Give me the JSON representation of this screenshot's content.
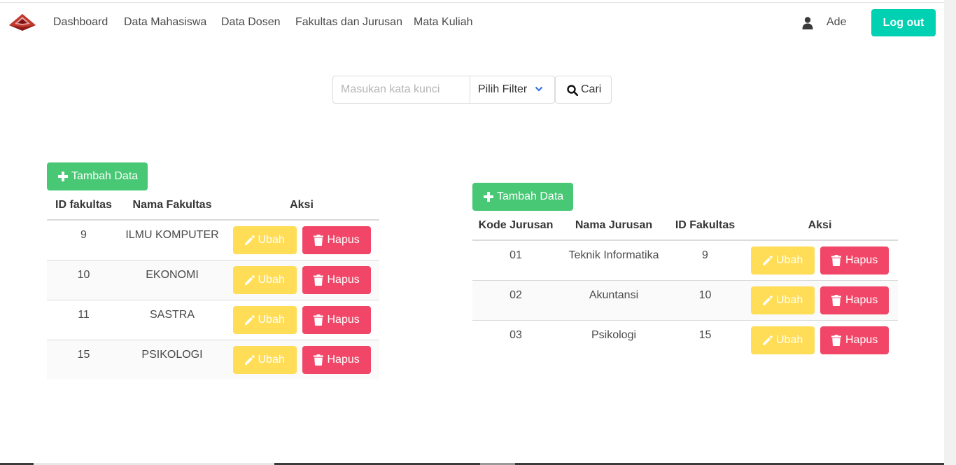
{
  "nav": {
    "items": [
      "Dashboard",
      "Data Mahasiswa",
      "Data Dosen",
      "Fakultas dan Jurusan",
      "Mata Kuliah"
    ],
    "user": "Ade",
    "logout": "Log out"
  },
  "search": {
    "placeholder": "Masukan kata kunci",
    "filter": "Pilih Filter",
    "button": "Cari"
  },
  "fakultas": {
    "add_label": "Tambah Data",
    "headers": [
      "ID fakultas",
      "Nama Fakultas",
      "Aksi"
    ],
    "rows": [
      {
        "id": "9",
        "nama": "ILMU KOMPUTER"
      },
      {
        "id": "10",
        "nama": "EKONOMI"
      },
      {
        "id": "11",
        "nama": "SASTRA"
      },
      {
        "id": "15",
        "nama": "PSIKOLOGI"
      }
    ]
  },
  "jurusan": {
    "add_label": "Tambah Data",
    "headers": [
      "Kode Jurusan",
      "Nama Jurusan",
      "ID Fakultas",
      "Aksi"
    ],
    "rows": [
      {
        "kode": "01",
        "nama": "Teknik Informatika",
        "id_fakultas": "9"
      },
      {
        "kode": "02",
        "nama": "Akuntansi",
        "id_fakultas": "10"
      },
      {
        "kode": "03",
        "nama": "Psikologi",
        "id_fakultas": "15"
      }
    ]
  },
  "actions": {
    "edit": "Ubah",
    "delete": "Hapus"
  },
  "icons": {
    "logo": "pyramid-logo-icon",
    "user": "user-icon",
    "search": "search-icon",
    "plus": "plus-icon",
    "pencil": "pencil-icon",
    "trash": "trash-icon",
    "chevron": "chevron-down-icon"
  },
  "colors": {
    "primary": "#00d1b2",
    "success": "#48c774",
    "warning": "#ffdd57",
    "danger": "#f14668"
  }
}
